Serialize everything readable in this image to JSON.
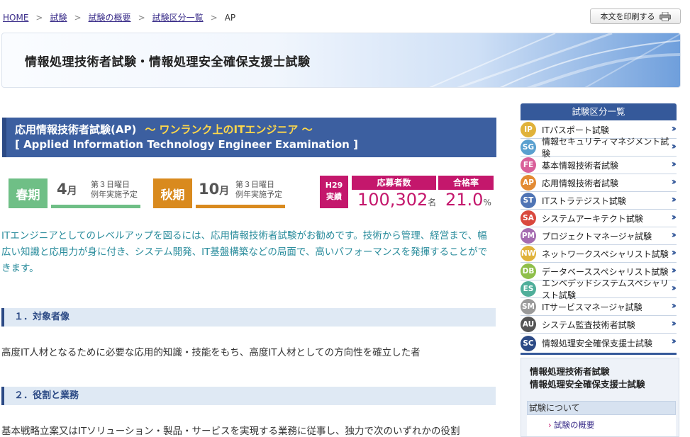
{
  "breadcrumb": {
    "items": [
      "HOME",
      "試験",
      "試験の概要",
      "試験区分一覧"
    ],
    "current": "AP"
  },
  "print_button": {
    "label": "本文を印刷する",
    "icon": "printer-icon"
  },
  "banner": {
    "title": "情報処理技術者試験・情報処理安全確保支援士試験"
  },
  "exam": {
    "title_jp": "応用情報技術者試験(AP)",
    "tagline": "～ ワンランク上のITエンジニア ～",
    "title_en": "[ Applied Information Technology Engineer Examination ]"
  },
  "schedule": {
    "spring": {
      "label": "春期",
      "month": "4",
      "month_unit": "月",
      "note1": "第３日曜日",
      "note2": "例年実施予定"
    },
    "autumn": {
      "label": "秋期",
      "month": "10",
      "month_unit": "月",
      "note1": "第３日曜日",
      "note2": "例年実施予定"
    }
  },
  "stats": {
    "year_line1": "H29",
    "year_line2": "実績",
    "applicants_label": "応募者数",
    "applicants_value": "100,302",
    "applicants_unit": "名",
    "pass_rate_label": "合格率",
    "pass_rate_value": "21.0",
    "pass_rate_unit": "%"
  },
  "intro": "ITエンジニアとしてのレベルアップを図るには、応用情報技術者試験がお勧めです。技術から管理、経営まで、幅広い知識と応用力が身に付き、システム開発、IT基盤構築などの局面で、高いパフォーマンスを発揮することができます。",
  "sections": [
    {
      "heading": "１．対象者像",
      "body": "高度IT人材となるために必要な応用的知識・技能をもち、高度IT人材としての方向性を確立した者"
    },
    {
      "heading": "２．役割と業務",
      "body": "基本戦略立案又はITソリューション・製品・サービスを実現する業務に従事し、独力で次のいずれかの役割"
    }
  ],
  "sidebar": {
    "title": "試験区分一覧",
    "items": [
      {
        "code": "IP",
        "label": "ITパスポート試験",
        "color": "#e0b23a"
      },
      {
        "code": "SG",
        "label": "情報セキュリティマネジメント試験",
        "color": "#5aa0cf"
      },
      {
        "code": "FE",
        "label": "基本情報技術者試験",
        "color": "#d9609a"
      },
      {
        "code": "AP",
        "label": "応用情報技術者試験",
        "color": "#e38b34"
      },
      {
        "code": "ST",
        "label": "ITストラテジスト試験",
        "color": "#4f74b5"
      },
      {
        "code": "SA",
        "label": "システムアーキテクト試験",
        "color": "#d9483d"
      },
      {
        "code": "PM",
        "label": "プロジェクトマネージャ試験",
        "color": "#a56bb0"
      },
      {
        "code": "NW",
        "label": "ネットワークスペシャリスト試験",
        "color": "#e0b23a"
      },
      {
        "code": "DB",
        "label": "データベーススペシャリスト試験",
        "color": "#8fbf4a"
      },
      {
        "code": "ES",
        "label": "エンベデッドシステムスペシャリスト試験",
        "color": "#4fae9a"
      },
      {
        "code": "SM",
        "label": "ITサービスマネージャ試験",
        "color": "#9a9a9a"
      },
      {
        "code": "AU",
        "label": "システム監査技術者試験",
        "color": "#555555"
      },
      {
        "code": "SC",
        "label": "情報処理安全確保支援士試験",
        "color": "#2c4a85"
      }
    ],
    "box_title_1": "情報処理技術者試験",
    "box_title_2": "情報処理安全確保支援士試験",
    "box_subheading": "試験について",
    "box_link": "試験の概要"
  }
}
